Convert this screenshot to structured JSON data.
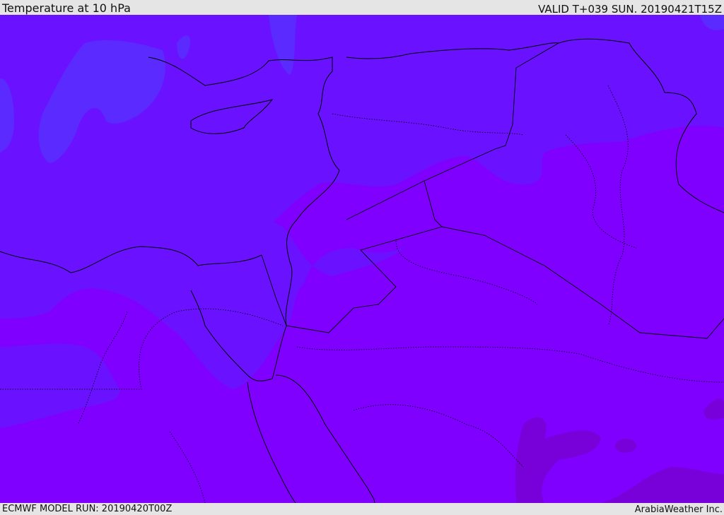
{
  "header": {
    "title": "Temperature at 10 hPa",
    "valid_time": "VALID T+039 SUN. 20190421T15Z"
  },
  "footer": {
    "model_run": "ECMWF MODEL RUN: 20190420T00Z",
    "credit": "ArabiaWeather Inc."
  },
  "colors": {
    "warmest_band": "#8000ff",
    "mid_band": "#6a12ff",
    "cool_band": "#5a2aff",
    "dark_band": "#7800d8",
    "border": "#000000"
  }
}
